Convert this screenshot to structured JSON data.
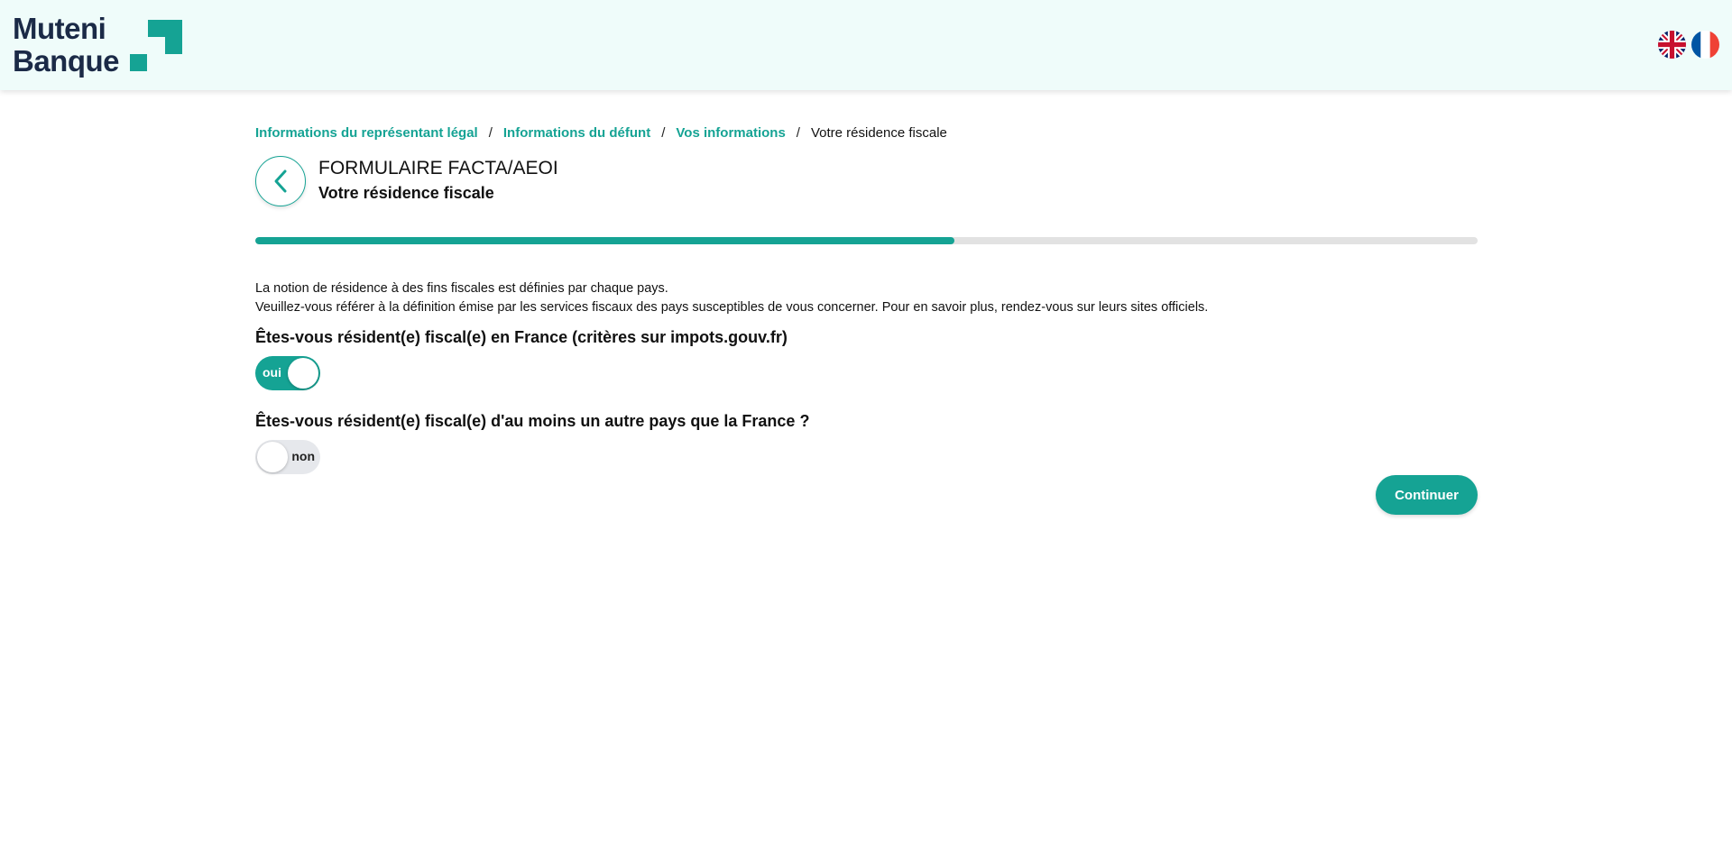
{
  "brand": {
    "name_line1": "Muteni",
    "name_line2": "Banque",
    "accent_color": "#15a394",
    "text_color": "#1b2a47"
  },
  "header": {
    "languages": [
      {
        "name": "english",
        "icon": "uk-flag-icon"
      },
      {
        "name": "french",
        "icon": "fr-flag-icon"
      }
    ]
  },
  "breadcrumb": {
    "items": [
      {
        "label": "Informations du représentant légal"
      },
      {
        "label": "Informations du défunt"
      },
      {
        "label": "Vos informations"
      }
    ],
    "separator": "/",
    "current": "Votre résidence fiscale"
  },
  "page": {
    "title": "FORMULAIRE FACTA/AEOI",
    "subtitle": "Votre résidence fiscale",
    "back_icon": "chevron-left-icon"
  },
  "progress": {
    "fraction": 0.572
  },
  "info": {
    "line1": "La notion de résidence à des fins fiscales est définies par chaque pays.",
    "line2": "Veuillez-vous référer à la définition émise par les services fiscaux des pays susceptibles de vous concerner. Pour en savoir plus, rendez-vous sur leurs sites officiels."
  },
  "questions": [
    {
      "label": "Êtes-vous résident(e) fiscal(e) en France (critères sur impots.gouv.fr)",
      "toggle_label": "oui",
      "checked": true
    },
    {
      "label": "Êtes-vous résident(e) fiscal(e) d'au moins un autre pays que la France ?",
      "toggle_label": "non",
      "checked": false
    }
  ],
  "actions": {
    "continue_label": "Continuer"
  }
}
